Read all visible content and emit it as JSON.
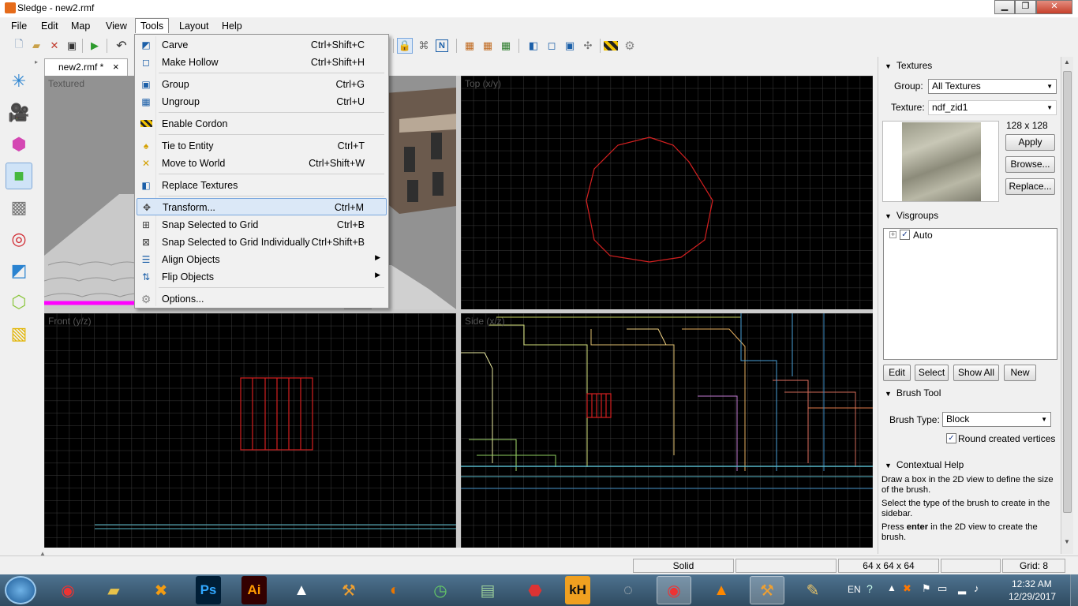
{
  "window": {
    "title": "Sledge - new2.rmf",
    "min_label": "▁",
    "max_label": "❐",
    "close_label": "✕"
  },
  "menubar": [
    {
      "label": "File"
    },
    {
      "label": "Edit"
    },
    {
      "label": "Map"
    },
    {
      "label": "View"
    },
    {
      "label": "Tools"
    },
    {
      "label": "Layout"
    },
    {
      "label": "Help"
    }
  ],
  "document_tab": {
    "label": "new2.rmf *",
    "close": "×"
  },
  "viewports": {
    "textured": "Textured",
    "top": "Top (x/y)",
    "front": "Front (y/z)",
    "side": "Side (x/z)"
  },
  "tools_menu": {
    "items": [
      {
        "label": "Carve",
        "shortcut": "Ctrl+Shift+C",
        "icon": "carve-icon"
      },
      {
        "label": "Make Hollow",
        "shortcut": "Ctrl+Shift+H",
        "icon": "hollow-icon"
      },
      {
        "label": "Group",
        "shortcut": "Ctrl+G",
        "icon": "group-icon"
      },
      {
        "label": "Ungroup",
        "shortcut": "Ctrl+U",
        "icon": "ungroup-icon"
      },
      {
        "label": "Enable Cordon",
        "shortcut": "",
        "icon": "cordon-icon"
      },
      {
        "label": "Tie to Entity",
        "shortcut": "Ctrl+T",
        "icon": "tie-entity-icon"
      },
      {
        "label": "Move to World",
        "shortcut": "Ctrl+Shift+W",
        "icon": "move-world-icon"
      },
      {
        "label": "Replace Textures",
        "shortcut": "",
        "icon": "replace-textures-icon"
      },
      {
        "label": "Transform...",
        "shortcut": "Ctrl+M",
        "icon": "transform-icon"
      },
      {
        "label": "Snap Selected to Grid",
        "shortcut": "Ctrl+B",
        "icon": "snap-icon"
      },
      {
        "label": "Snap Selected to Grid Individually",
        "shortcut": "Ctrl+Shift+B",
        "icon": "snap-individually-icon"
      },
      {
        "label": "Align Objects",
        "shortcut": "",
        "submenu": "▶",
        "icon": "align-icon"
      },
      {
        "label": "Flip Objects",
        "shortcut": "",
        "submenu": "▶",
        "icon": "flip-icon"
      },
      {
        "label": "Options...",
        "shortcut": "",
        "icon": "options-gear-icon"
      }
    ]
  },
  "textures": {
    "header": "Textures",
    "group_label": "Group:",
    "group_value": "All Textures",
    "texture_label": "Texture:",
    "texture_value": "ndf_zid1",
    "size": "128 x 128",
    "apply": "Apply",
    "browse": "Browse...",
    "replace": "Replace..."
  },
  "visgroups": {
    "header": "Visgroups",
    "expander": "+",
    "check": "✓",
    "item": "Auto",
    "edit": "Edit",
    "select": "Select",
    "show_all": "Show All",
    "new": "New"
  },
  "brush_tool": {
    "header": "Brush Tool",
    "type_label": "Brush Type:",
    "type_value": "Block",
    "round_check": "✓",
    "round_label": "Round created vertices"
  },
  "contextual_help": {
    "header": "Contextual Help",
    "line1": "Draw a box in the 2D view to define the size of the brush.",
    "line2": "Select the type of the brush to create in the sidebar.",
    "line3_a": "Press ",
    "line3_bold": "enter",
    "line3_b": " in the 2D view to create the brush."
  },
  "statusbar": {
    "mode": "Solid",
    "dims": "64 x 64 x 64",
    "grid": "Grid: 8"
  },
  "tray": {
    "lang": "EN",
    "time": "12:32 AM",
    "date": "12/29/2017"
  },
  "taskbar_glyphs": {
    "ps": "Ps",
    "ai": "Ai",
    "kh": "kH"
  },
  "colors": {
    "selection_red": "#d42020",
    "grid": "#3c3c3c",
    "menu_highlight": "#dbe8f7"
  }
}
